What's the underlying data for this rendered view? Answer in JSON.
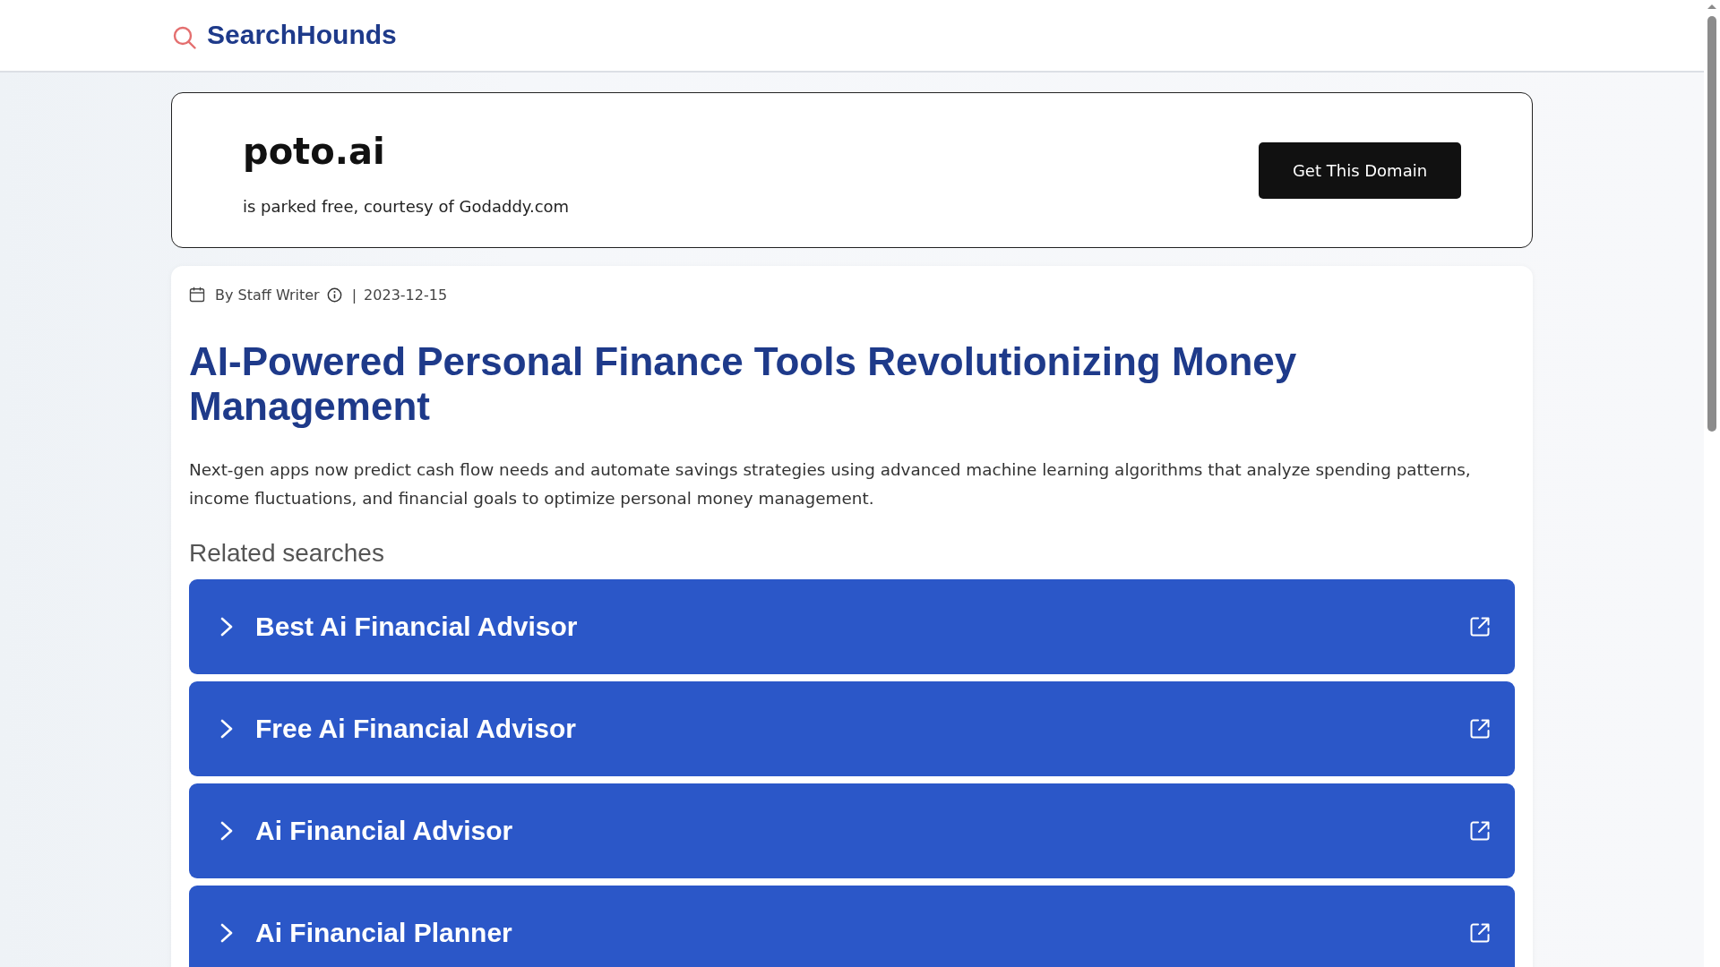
{
  "header": {
    "logo_text": "SearchHounds"
  },
  "domain_banner": {
    "domain": "poto.ai",
    "subtitle": "is parked free, courtesy of Godaddy.com",
    "button": "Get This Domain"
  },
  "article": {
    "author": "By Staff Writer",
    "separator": "|",
    "date": "2023-12-15",
    "title": "AI-Powered Personal Finance Tools Revolutionizing Money Management",
    "summary": "Next-gen apps now predict cash flow needs and automate savings strategies using advanced machine learning algorithms that analyze spending patterns, income fluctuations, and financial goals to optimize personal money management."
  },
  "related_searches": {
    "heading": "Related searches",
    "items": [
      {
        "label": "Best Ai Financial Advisor"
      },
      {
        "label": "Free Ai Financial Advisor"
      },
      {
        "label": "Ai Financial Advisor"
      },
      {
        "label": "Ai Financial Planner"
      }
    ]
  }
}
